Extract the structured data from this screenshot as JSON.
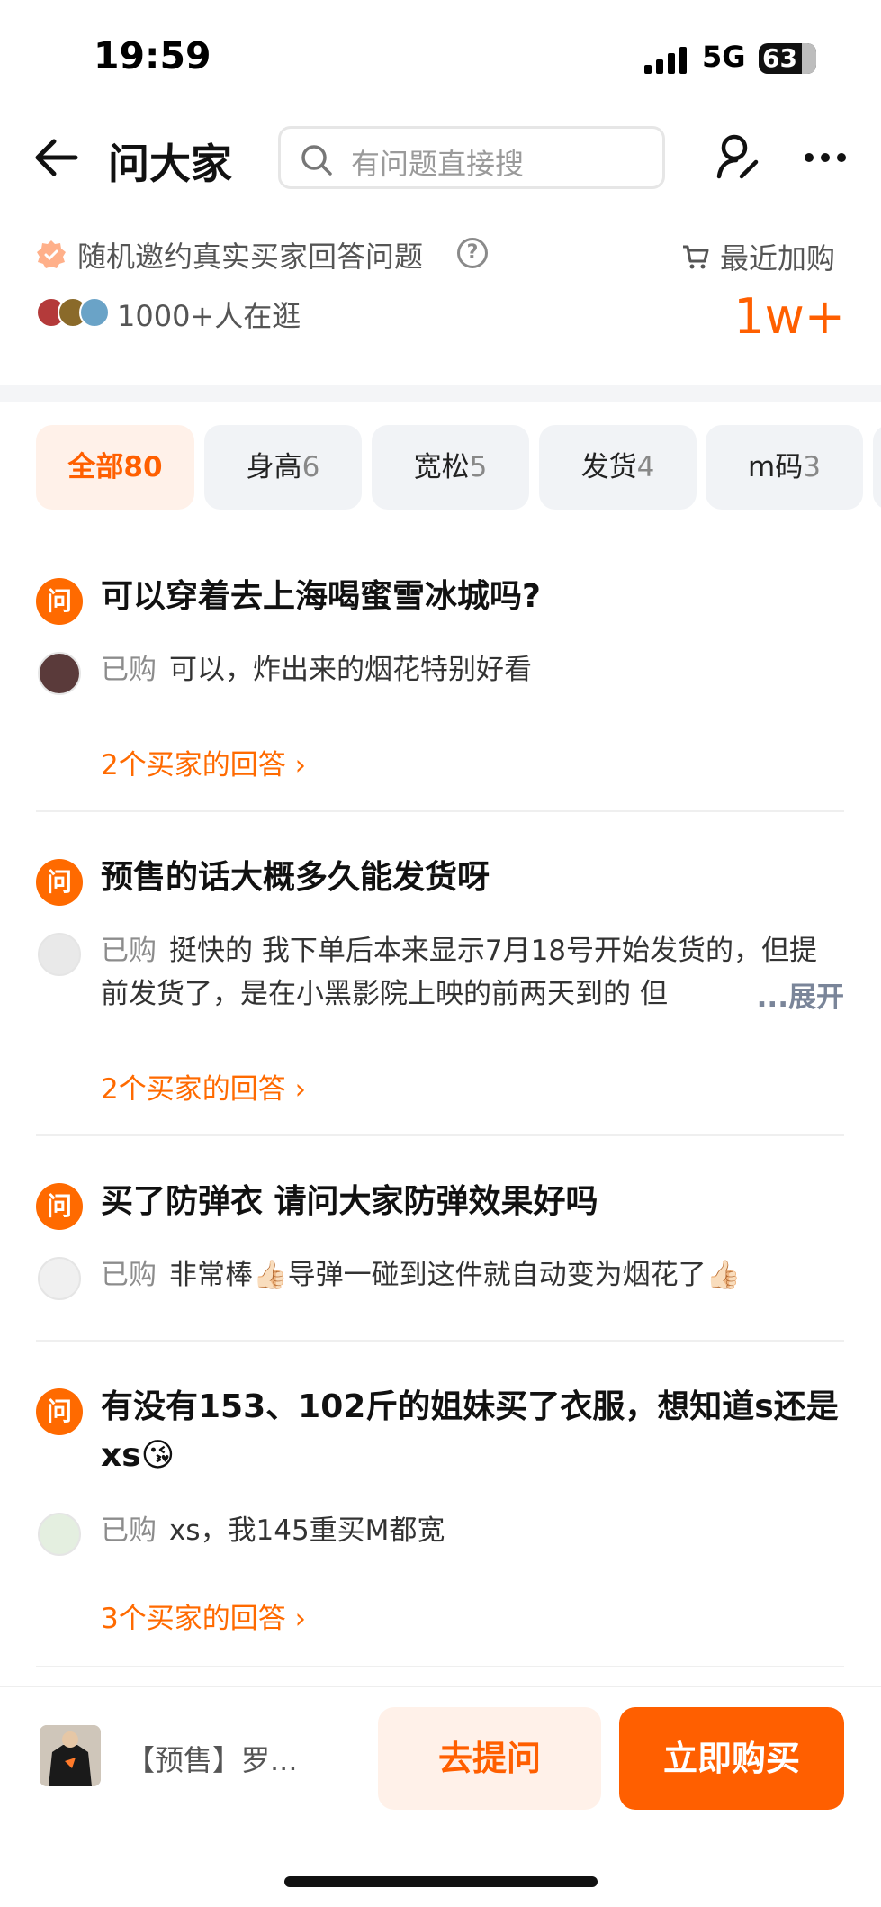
{
  "status_bar": {
    "time": "19:59",
    "network": "5G",
    "battery": "63"
  },
  "nav": {
    "title": "问大家",
    "search_placeholder": "有问题直接搜"
  },
  "info": {
    "invite_text": "随机邀约真实买家回答问题",
    "browsing_text": "1000+人在逛",
    "recent_label": "最近加购",
    "recent_count": "1w+"
  },
  "tabs": [
    {
      "label": "全部",
      "count": "80",
      "active": true
    },
    {
      "label": "身高",
      "count": "6",
      "active": false
    },
    {
      "label": "宽松",
      "count": "5",
      "active": false
    },
    {
      "label": "发货",
      "count": "4",
      "active": false
    },
    {
      "label": "m码",
      "count": "3",
      "active": false
    }
  ],
  "questions": [
    {
      "icon_label": "问",
      "question": "可以穿着去上海喝蜜雪冰城吗?",
      "bought_label": "已购",
      "answer": "可以，炸出来的烟花特别好看",
      "answers_link": "2个买家的回答"
    },
    {
      "icon_label": "问",
      "question": "预售的话大概多久能发货呀",
      "bought_label": "已购",
      "answer": "挺快的 我下单后本来显示7月18号开始发货的，但提前发货了，是在小黑影院上映的前两天到的 但",
      "expand_label": "...展开",
      "answers_link": "2个买家的回答"
    },
    {
      "icon_label": "问",
      "question": "买了防弹衣 请问大家防弹效果好吗",
      "bought_label": "已购",
      "answer": "非常棒👍🏻导弹一碰到这件就自动变为烟花了👍🏻"
    },
    {
      "icon_label": "问",
      "question": "有没有153、102斤的姐妹买了衣服，想知道s还是xs😘",
      "bought_label": "已购",
      "answer": "xs，我145重买M都宽",
      "answers_link": "3个买家的回答"
    }
  ],
  "bottom_bar": {
    "product_title": "【预售】罗...",
    "ask_label": "去提问",
    "buy_label": "立即购买"
  },
  "colors": {
    "accent": "#ff5f00",
    "accent_light": "#fff1e9"
  },
  "icons": [
    "back-arrow-icon",
    "search-icon",
    "user-edit-icon",
    "more-icon",
    "verified-badge-icon",
    "help-icon",
    "cart-icon",
    "chevron-right-icon"
  ]
}
